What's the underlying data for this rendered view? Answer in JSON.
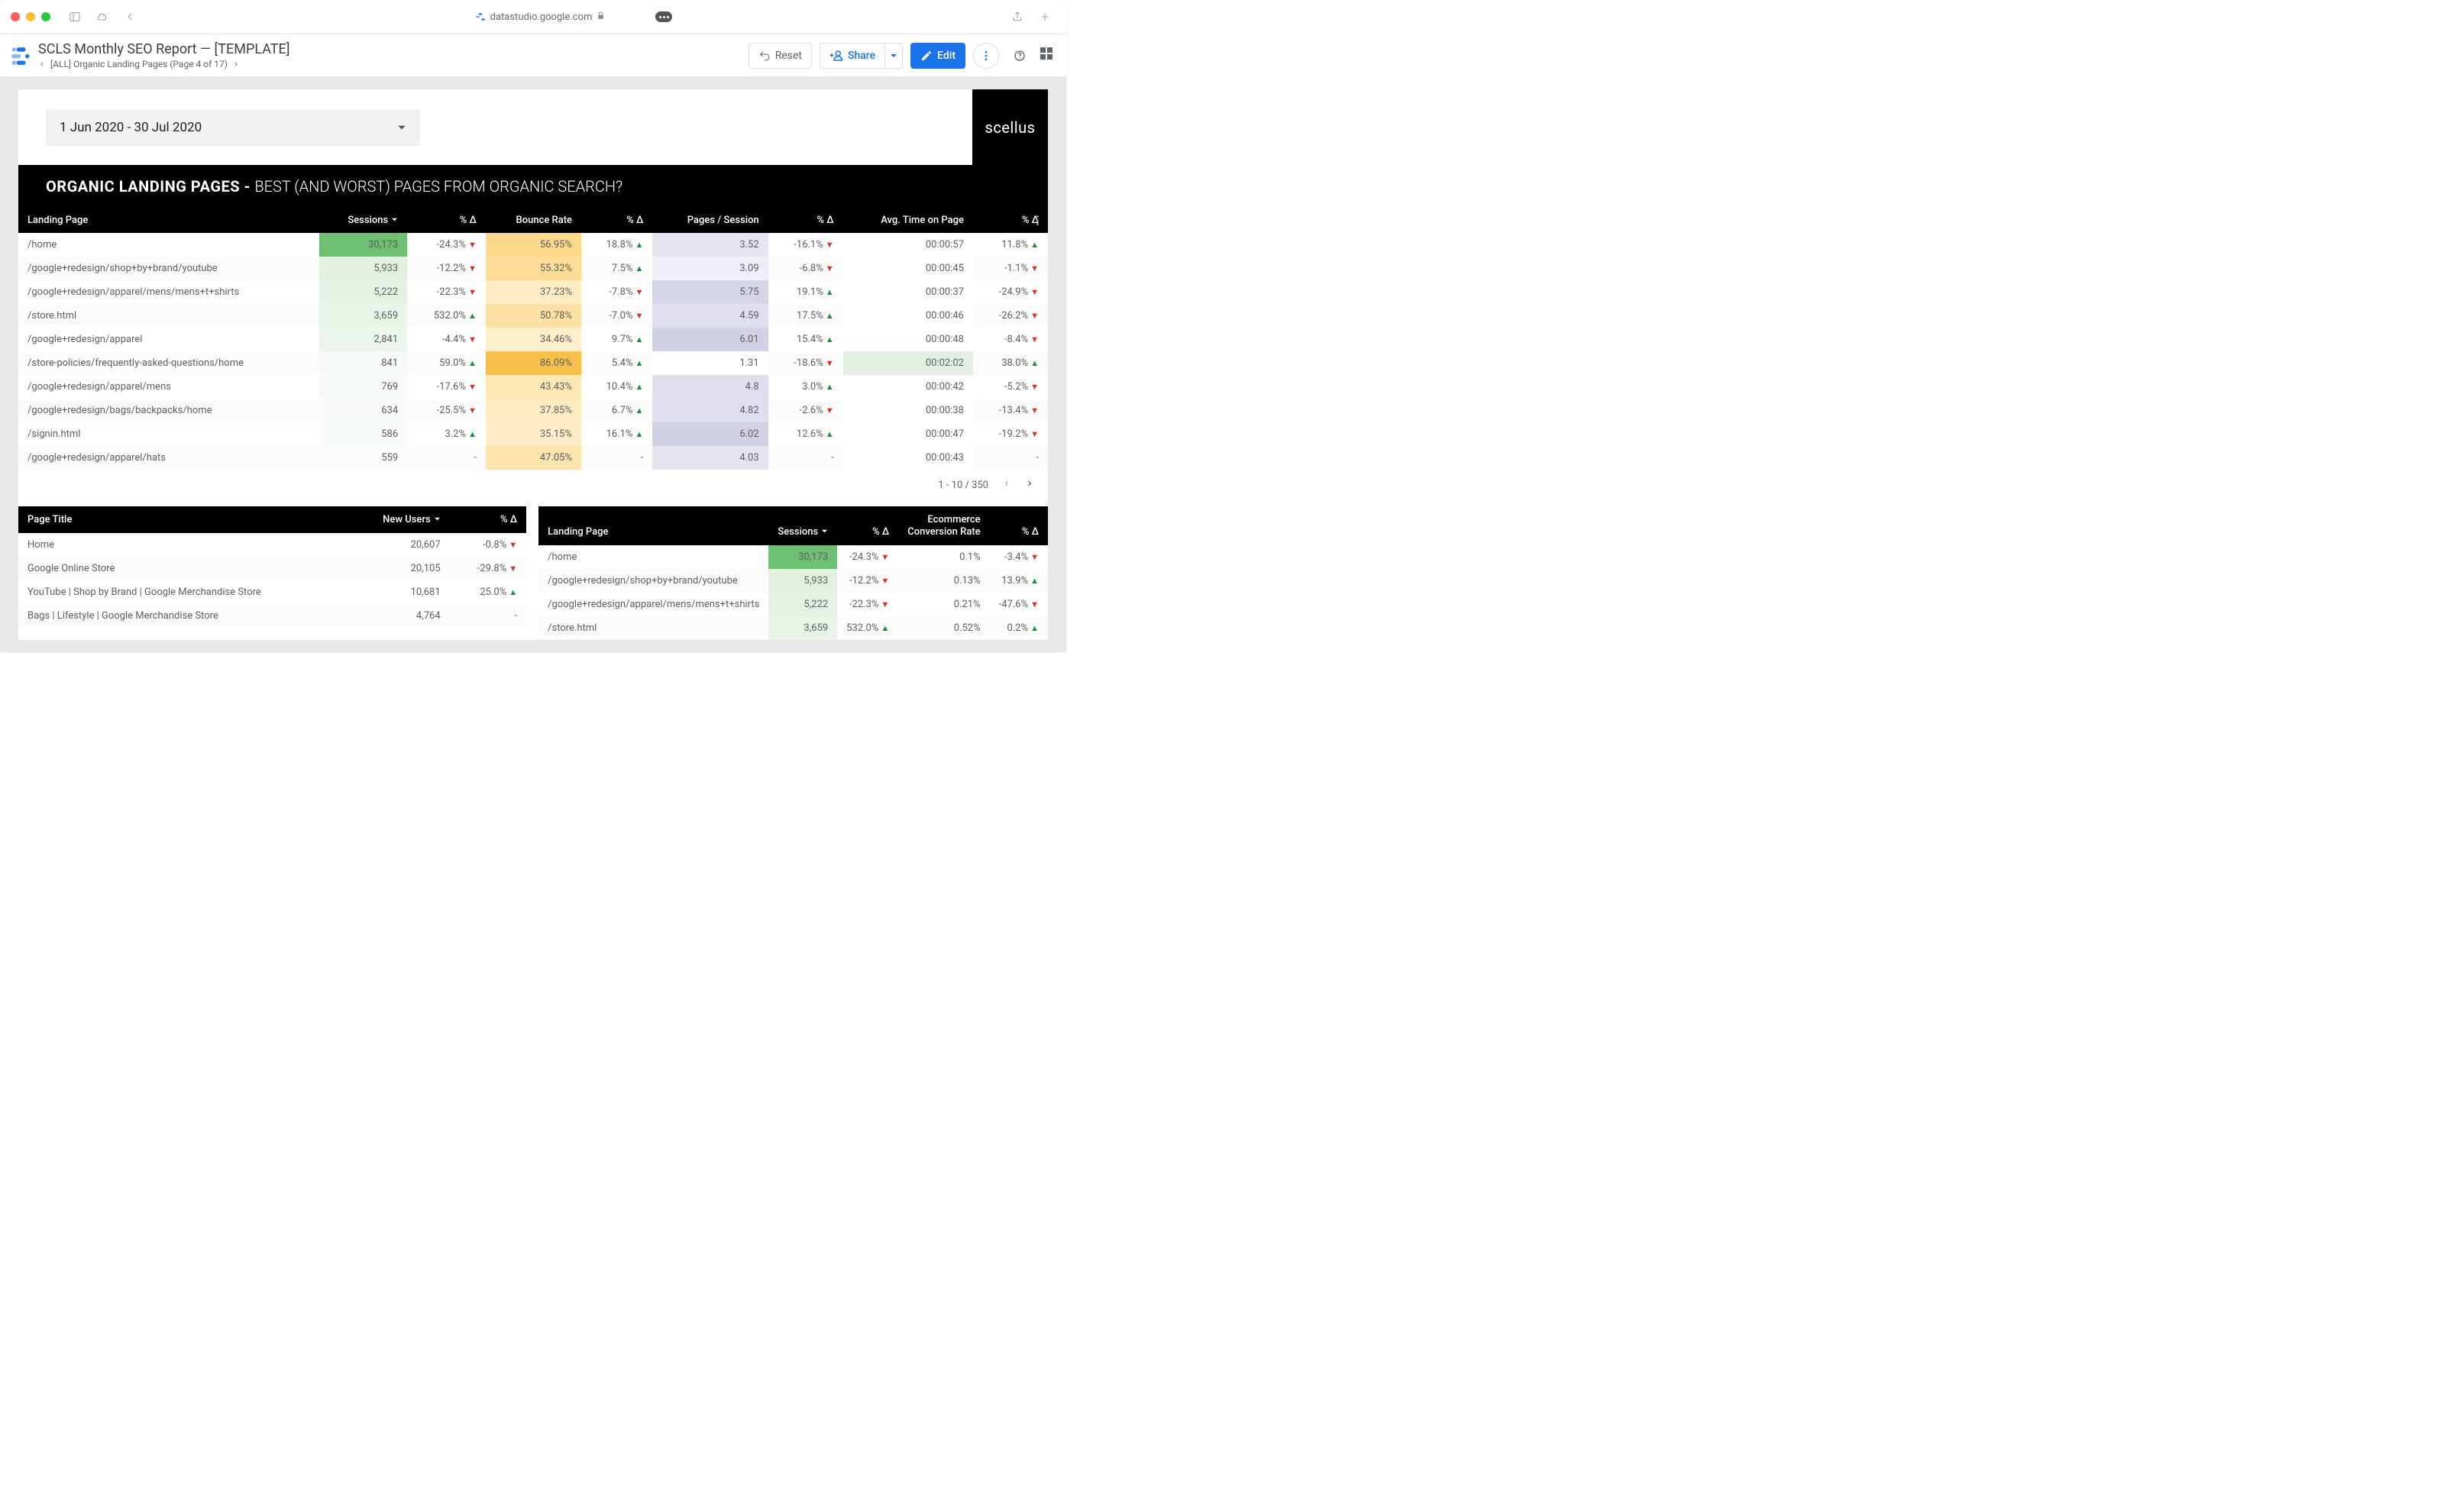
{
  "browser": {
    "url": "datastudio.google.com"
  },
  "header": {
    "title": "SCLS Monthly SEO Report — [TEMPLATE]",
    "breadcrumb": "[ALL] Organic Landing Pages (Page 4 of 17)",
    "reset": "Reset",
    "share": "Share",
    "edit": "Edit"
  },
  "report": {
    "date_range": "1 Jun 2020 - 30 Jul 2020",
    "brand": "scellus",
    "section_title_bold": "ORGANIC LANDING PAGES - ",
    "section_title_rest": "BEST (AND WORST) PAGES FROM ORGANIC SEARCH?"
  },
  "main_table": {
    "columns": [
      "Landing Page",
      "Sessions",
      "% Δ",
      "Bounce Rate",
      "% Δ",
      "Pages / Session",
      "% Δ",
      "Avg. Time on Page",
      "% Δ"
    ],
    "pager": "1 - 10 / 350",
    "rows": [
      {
        "page": "/home",
        "sessions": "30,173",
        "s_bg": "#6fbf73",
        "d1": "-24.3%",
        "d1d": "down",
        "bounce": "56.95%",
        "b_bg": "#fdd98b",
        "d2": "18.8%",
        "d2d": "up",
        "pps": "3.52",
        "p_bg": "#e5e5f2",
        "d3": "-16.1%",
        "d3d": "down",
        "time": "00:00:57",
        "t_bg": "#ffffff",
        "d4": "11.8%",
        "d4d": "up"
      },
      {
        "page": "/google+redesign/shop+by+brand/youtube",
        "sessions": "5,933",
        "s_bg": "#e1f0e1",
        "d1": "-12.2%",
        "d1d": "down",
        "bounce": "55.32%",
        "b_bg": "#fddc95",
        "d2": "7.5%",
        "d2d": "up",
        "pps": "3.09",
        "p_bg": "#eeeef6",
        "d3": "-6.8%",
        "d3d": "down",
        "time": "00:00:45",
        "t_bg": "#ffffff",
        "d4": "-1.1%",
        "d4d": "down"
      },
      {
        "page": "/google+redesign/apparel/mens/mens+t+shirts",
        "sessions": "5,222",
        "s_bg": "#e4f1e4",
        "d1": "-22.3%",
        "d1d": "down",
        "bounce": "37.23%",
        "b_bg": "#feecc4",
        "d2": "-7.8%",
        "d2d": "down",
        "pps": "5.75",
        "p_bg": "#d5d5e9",
        "d3": "19.1%",
        "d3d": "up",
        "time": "00:00:37",
        "t_bg": "#ffffff",
        "d4": "-24.9%",
        "d4d": "down"
      },
      {
        "page": "/store.html",
        "sessions": "3,659",
        "s_bg": "#e9f4e9",
        "d1": "532.0%",
        "d1d": "up",
        "bounce": "50.78%",
        "b_bg": "#fde0a3",
        "d2": "-7.0%",
        "d2d": "down",
        "pps": "4.59",
        "p_bg": "#dfdfef",
        "d3": "17.5%",
        "d3d": "up",
        "time": "00:00:46",
        "t_bg": "#ffffff",
        "d4": "-26.2%",
        "d4d": "down"
      },
      {
        "page": "/google+redesign/apparel",
        "sessions": "2,841",
        "s_bg": "#edf6ed",
        "d1": "-4.4%",
        "d1d": "down",
        "bounce": "34.46%",
        "b_bg": "#feeecb",
        "d2": "9.7%",
        "d2d": "up",
        "pps": "6.01",
        "p_bg": "#d2d2e7",
        "d3": "15.4%",
        "d3d": "up",
        "time": "00:00:48",
        "t_bg": "#ffffff",
        "d4": "-8.4%",
        "d4d": "down"
      },
      {
        "page": "/store-policies/frequently-asked-questions/home",
        "sessions": "841",
        "s_bg": "#f6faf6",
        "d1": "59.0%",
        "d1d": "up",
        "bounce": "86.09%",
        "b_bg": "#f7c04a",
        "d2": "5.4%",
        "d2d": "up",
        "pps": "1.31",
        "p_bg": "#ffffff",
        "d3": "-18.6%",
        "d3d": "down",
        "time": "00:02:02",
        "t_bg": "#e3efe3",
        "d4": "38.0%",
        "d4d": "up"
      },
      {
        "page": "/google+redesign/apparel/mens",
        "sessions": "769",
        "s_bg": "#f7fbf7",
        "d1": "-17.6%",
        "d1d": "down",
        "bounce": "43.43%",
        "b_bg": "#fee7b5",
        "d2": "10.4%",
        "d2d": "up",
        "pps": "4.8",
        "p_bg": "#dedeee",
        "d3": "3.0%",
        "d3d": "up",
        "time": "00:00:42",
        "t_bg": "#ffffff",
        "d4": "-5.2%",
        "d4d": "down"
      },
      {
        "page": "/google+redesign/bags/backpacks/home",
        "sessions": "634",
        "s_bg": "#f8fbf8",
        "d1": "-25.5%",
        "d1d": "down",
        "bounce": "37.85%",
        "b_bg": "#feebc1",
        "d2": "6.7%",
        "d2d": "up",
        "pps": "4.82",
        "p_bg": "#dedeee",
        "d3": "-2.6%",
        "d3d": "down",
        "time": "00:00:38",
        "t_bg": "#ffffff",
        "d4": "-13.4%",
        "d4d": "down"
      },
      {
        "page": "/signin.html",
        "sessions": "586",
        "s_bg": "#f8fcf8",
        "d1": "3.2%",
        "d1d": "up",
        "bounce": "35.15%",
        "b_bg": "#feedc7",
        "d2": "16.1%",
        "d2d": "up",
        "pps": "6.02",
        "p_bg": "#d1d1e6",
        "d3": "12.6%",
        "d3d": "up",
        "time": "00:00:47",
        "t_bg": "#ffffff",
        "d4": "-19.2%",
        "d4d": "down"
      },
      {
        "page": "/google+redesign/apparel/hats",
        "sessions": "559",
        "s_bg": "#f9fcf9",
        "d1": "-",
        "d1d": "none",
        "bounce": "47.05%",
        "b_bg": "#fde4ac",
        "d2": "-",
        "d2d": "none",
        "pps": "4.03",
        "p_bg": "#e4e4f1",
        "d3": "-",
        "d3d": "none",
        "time": "00:00:43",
        "t_bg": "#ffffff",
        "d4": "-",
        "d4d": "none"
      }
    ]
  },
  "left_panel": {
    "columns": [
      "Page Title",
      "New Users",
      "% Δ"
    ],
    "rows": [
      {
        "title": "Home",
        "users": "20,607",
        "d": "-0.8%",
        "dd": "down"
      },
      {
        "title": "Google Online Store",
        "users": "20,105",
        "d": "-29.8%",
        "dd": "down"
      },
      {
        "title": "YouTube | Shop by Brand | Google Merchandise Store",
        "users": "10,681",
        "d": "25.0%",
        "dd": "up"
      },
      {
        "title": "Bags | Lifestyle | Google Merchandise Store",
        "users": "4,764",
        "d": "-",
        "dd": "none"
      }
    ]
  },
  "right_panel": {
    "columns": [
      "Landing Page",
      "Sessions",
      "% Δ",
      "Ecommerce Conversion Rate",
      "% Δ"
    ],
    "rows": [
      {
        "page": "/home",
        "sessions": "30,173",
        "s_bg": "#6fbf73",
        "d1": "-24.3%",
        "d1d": "down",
        "conv": "0.1%",
        "d2": "-3.4%",
        "d2d": "down"
      },
      {
        "page": "/google+redesign/shop+by+brand/youtube",
        "sessions": "5,933",
        "s_bg": "#e1f0e1",
        "d1": "-12.2%",
        "d1d": "down",
        "conv": "0.13%",
        "d2": "13.9%",
        "d2d": "up"
      },
      {
        "page": "/google+redesign/apparel/mens/mens+t+shirts",
        "sessions": "5,222",
        "s_bg": "#e4f1e4",
        "d1": "-22.3%",
        "d1d": "down",
        "conv": "0.21%",
        "d2": "-47.6%",
        "d2d": "down"
      },
      {
        "page": "/store.html",
        "sessions": "3,659",
        "s_bg": "#e9f4e9",
        "d1": "532.0%",
        "d1d": "up",
        "conv": "0.52%",
        "d2": "0.2%",
        "d2d": "up"
      }
    ]
  }
}
